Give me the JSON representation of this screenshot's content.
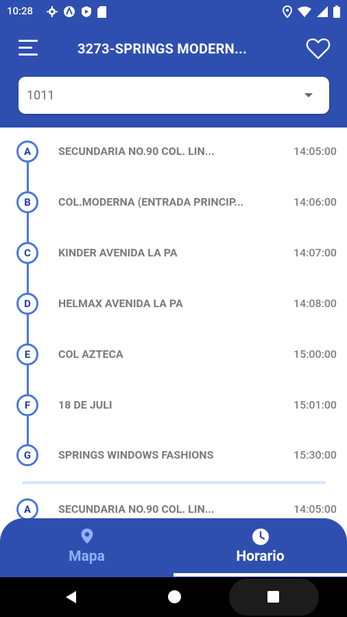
{
  "status_bar": {
    "time": "10:28"
  },
  "header": {
    "title": "3273-SPRINGS MODERN..."
  },
  "route_select": {
    "value": "1011"
  },
  "schedule": [
    {
      "letter": "A",
      "name": "SECUNDARIA NO.90 COL. LIN...",
      "time": "14:05:00"
    },
    {
      "letter": "B",
      "name": "COL.MODERNA (ENTRADA PRINCIP...",
      "time": "14:06:00"
    },
    {
      "letter": "C",
      "name": "KINDER  AVENIDA LA PA",
      "time": "14:07:00"
    },
    {
      "letter": "D",
      "name": "HELMAX  AVENIDA LA PA",
      "time": "14:08:00"
    },
    {
      "letter": "E",
      "name": "COL AZTECA",
      "time": "15:00:00"
    },
    {
      "letter": "F",
      "name": "18 DE JULI",
      "time": "15:01:00"
    },
    {
      "letter": "G",
      "name": "SPRINGS WINDOWS FASHIONS",
      "time": "15:30:00"
    }
  ],
  "schedule_next": [
    {
      "letter": "A",
      "name": "SECUNDARIA NO.90 COL. LIN...",
      "time": "14:05:00"
    }
  ],
  "bottom_nav": {
    "map_label": "Mapa",
    "schedule_label": "Horario",
    "active": "Horario"
  },
  "colors": {
    "primary": "#2f4fb0",
    "accent_line": "#4a78d9",
    "inactive_tab": "#8fb0ff"
  }
}
